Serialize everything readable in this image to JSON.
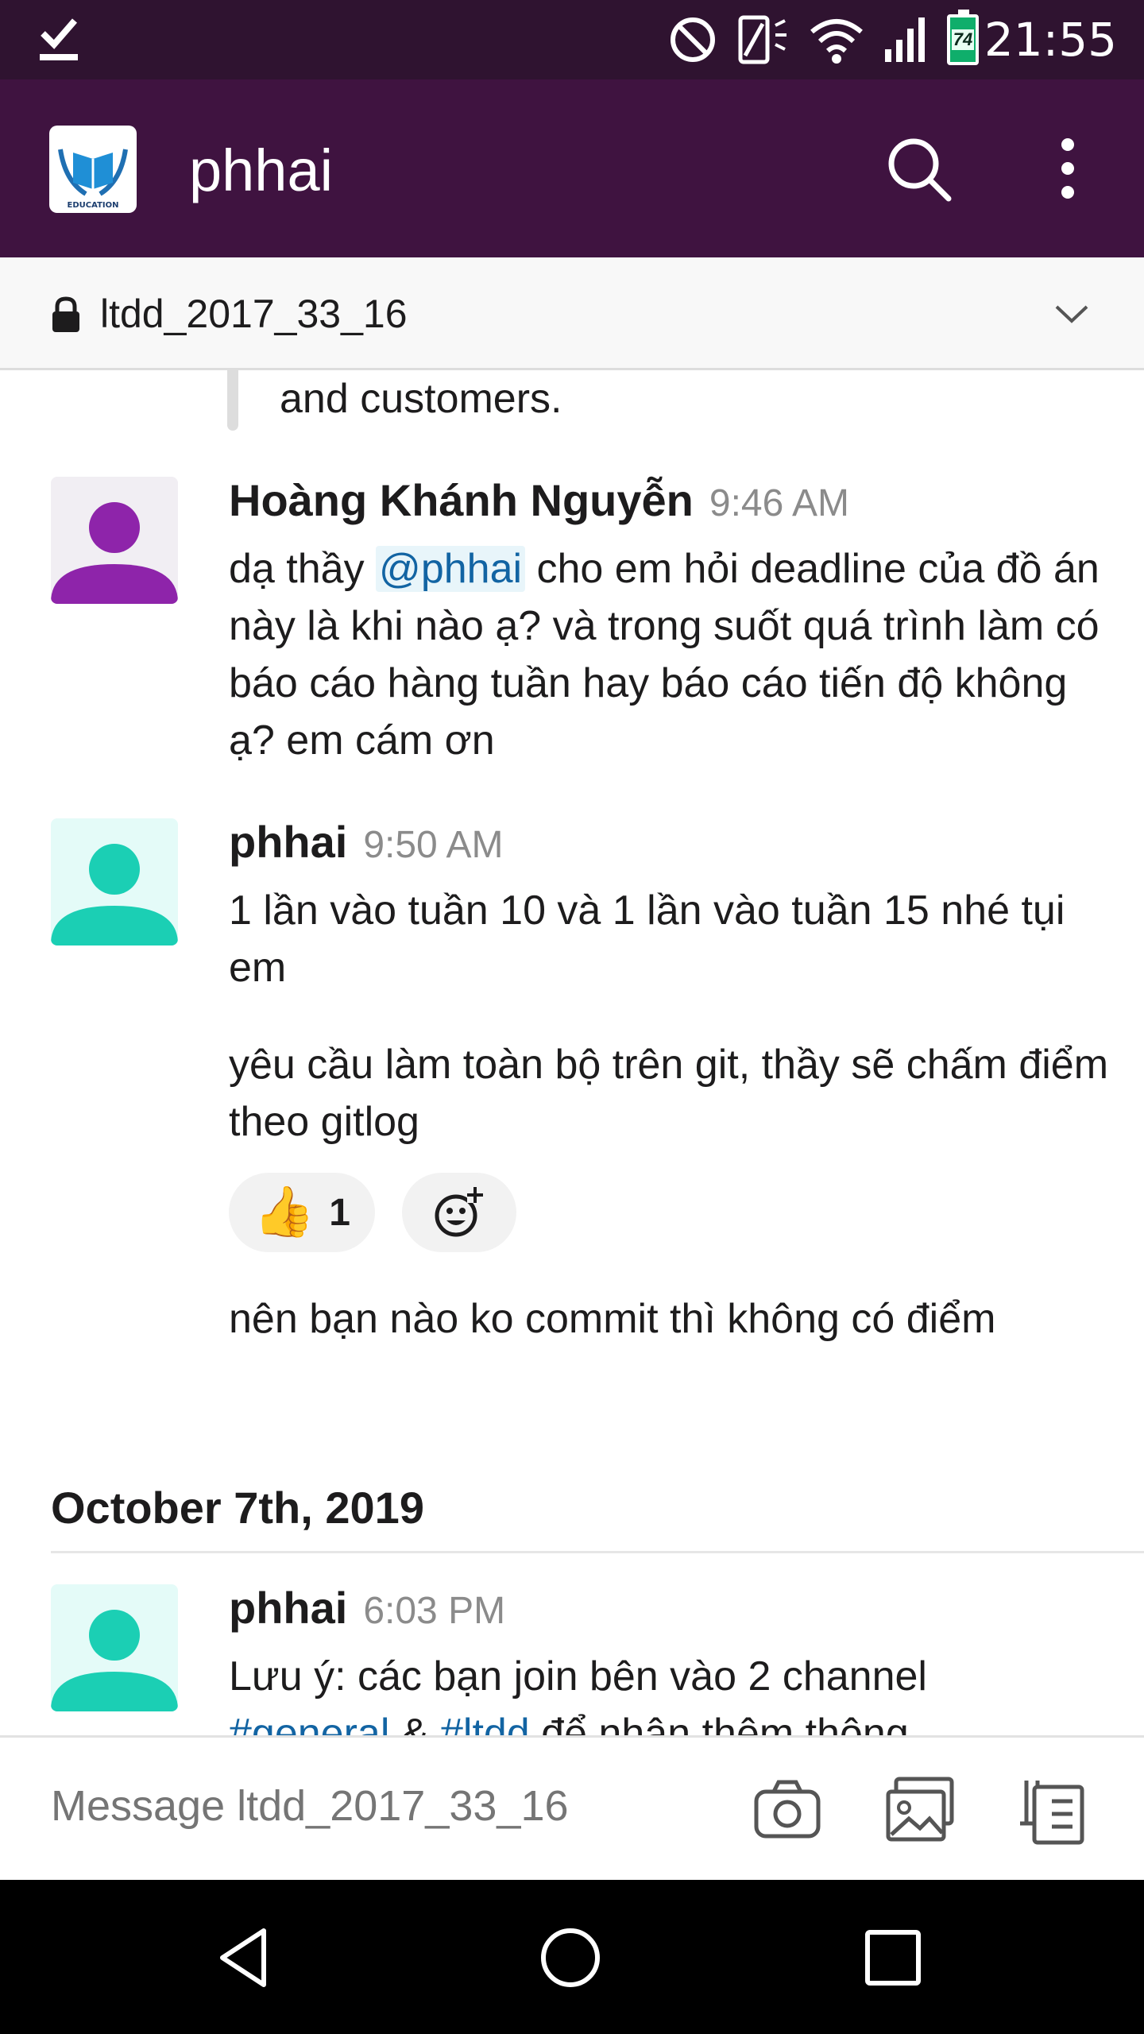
{
  "status_bar": {
    "time": "21:55",
    "battery_level": "74",
    "icons": [
      "checkmark-icon",
      "do-not-disturb-icon",
      "vibrate-icon",
      "wifi-icon",
      "signal-icon",
      "battery-icon"
    ]
  },
  "header": {
    "team_name": "phhai",
    "logo_text": "EDUCATION",
    "icons": [
      "search-icon",
      "more-vert-icon"
    ]
  },
  "channel": {
    "name": "ltdd_2017_33_16",
    "icons": [
      "lock-icon",
      "chevron-down-icon"
    ]
  },
  "messages": {
    "quoted_tail": "and customers.",
    "m1": {
      "author": "Hoàng Khánh Nguyễn",
      "time": "9:46 AM",
      "text_before": "dạ thầy ",
      "mention": "@phhai",
      "text_after": " cho em hỏi deadline của đồ án này là khi nào ạ? và trong suốt quá trình làm có báo cáo hàng tuần hay báo cáo tiến độ không ạ? em cám ơn"
    },
    "m2": {
      "author": "phhai",
      "time": "9:50 AM",
      "text": "1 lần vào tuần 10 và 1 lần vào tuần 15 nhé tụi em"
    },
    "m3": {
      "text": "yêu cầu làm toàn bộ trên git, thầy sẽ chấm điểm theo gitlog",
      "reaction_emoji": "👍",
      "reaction_count": "1"
    },
    "m4": {
      "text": "nên bạn nào ko commit thì không có điểm"
    },
    "day_divider": "October 7th, 2019",
    "m5": {
      "author": "phhai",
      "time": "6:03 PM",
      "text": "Lưu ý: các bạn join bên vào 2 channel",
      "link1": "#general",
      "amp": " & ",
      "link2": "#ltdd",
      "text_after": " để nhận thêm thông"
    }
  },
  "composer": {
    "placeholder": "Message ltdd_2017_33_16",
    "icons": [
      "camera-icon",
      "photo-library-icon",
      "files-icon"
    ]
  },
  "nav": {
    "icons": [
      "back-icon",
      "home-icon",
      "recents-icon"
    ]
  },
  "colors": {
    "status_bar_bg": "#2f1330",
    "header_bg": "#3f1340",
    "mention": "#1264a3",
    "avatar_purple": "#8e24aa",
    "avatar_teal": "#1bcfb4"
  }
}
